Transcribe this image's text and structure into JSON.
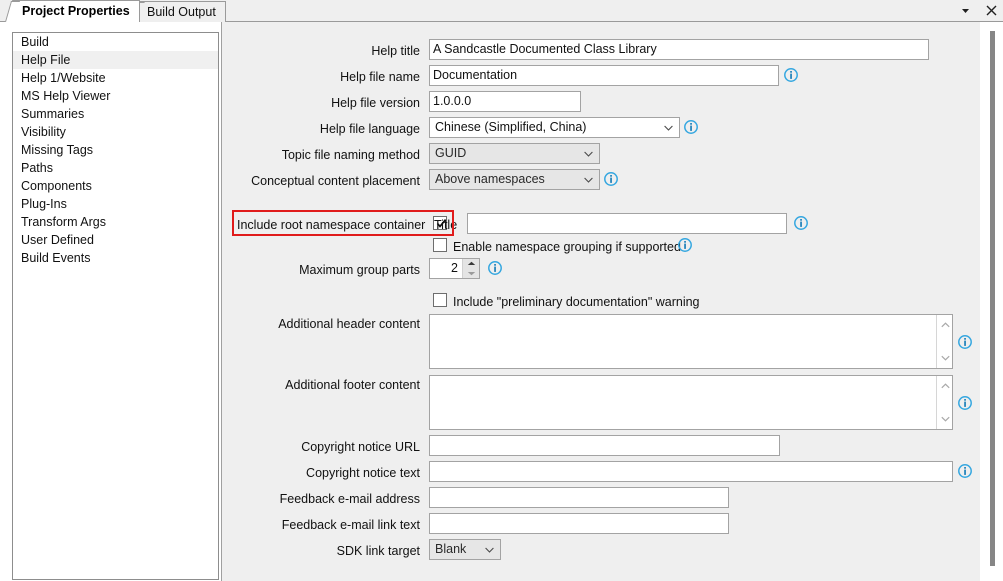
{
  "window": {
    "tabs": [
      {
        "id": "project-properties",
        "label": "Project Properties",
        "active": true
      },
      {
        "id": "build-output",
        "label": "Build Output",
        "active": false
      }
    ],
    "controls": {
      "dropdown_label": "window-dropdown",
      "close_label": "close-window"
    }
  },
  "sidebar": {
    "name": "property-category-list",
    "selected": "Help File",
    "items": [
      {
        "label": "Build"
      },
      {
        "label": "Help File"
      },
      {
        "label": "Help 1/Website"
      },
      {
        "label": "MS Help Viewer"
      },
      {
        "label": "Summaries"
      },
      {
        "label": "Visibility"
      },
      {
        "label": "Missing Tags"
      },
      {
        "label": "Paths"
      },
      {
        "label": "Components"
      },
      {
        "label": "Plug-Ins"
      },
      {
        "label": "Transform Args"
      },
      {
        "label": "User Defined"
      },
      {
        "label": "Build Events"
      }
    ]
  },
  "form": {
    "help_title": {
      "label": "Help title",
      "value": "A Sandcastle Documented Class Library"
    },
    "help_file_name": {
      "label": "Help file name",
      "value": "Documentation"
    },
    "help_file_version": {
      "label": "Help file version",
      "value": "1.0.0.0"
    },
    "help_file_language": {
      "label": "Help file language",
      "value": "Chinese (Simplified, China)"
    },
    "topic_file_naming_method": {
      "label": "Topic file naming method",
      "value": "GUID"
    },
    "conceptual_content_placement": {
      "label": "Conceptual content placement",
      "value": "Above namespaces"
    },
    "include_root_namespace_container": {
      "label": "Include root namespace container",
      "checked": true
    },
    "title": {
      "label": "Title",
      "value": ""
    },
    "enable_namespace_grouping": {
      "label": "Enable namespace grouping if supported",
      "checked": false
    },
    "maximum_group_parts": {
      "label": "Maximum group parts",
      "value": "2"
    },
    "include_preliminary_warning": {
      "label": "Include \"preliminary documentation\" warning",
      "checked": false
    },
    "additional_header_content": {
      "label": "Additional header content",
      "value": ""
    },
    "additional_footer_content": {
      "label": "Additional footer content",
      "value": ""
    },
    "copyright_notice_url": {
      "label": "Copyright notice URL",
      "value": ""
    },
    "copyright_notice_text": {
      "label": "Copyright notice text",
      "value": ""
    },
    "feedback_email_address": {
      "label": "Feedback e-mail address",
      "value": ""
    },
    "feedback_email_link_text": {
      "label": "Feedback e-mail link text",
      "value": ""
    },
    "sdk_link_target": {
      "label": "SDK link target",
      "value": "Blank"
    }
  },
  "icons": {
    "info": "info-icon",
    "chevron_down": "chevron-down-icon",
    "checkmark": "checkmark-icon",
    "spinner_up": "spinner-up-icon",
    "spinner_down": "spinner-down-icon",
    "close": "close-icon"
  },
  "colors": {
    "panel_background": "#efefef",
    "highlight_box": "#e01b1b",
    "info_icon": "#35a7e0",
    "selected_item": "#f0f0f0",
    "border": "#a3a3a3"
  },
  "highlight": {
    "name": "include-root-namespace-container-highlight",
    "target": "Include root namespace container"
  }
}
